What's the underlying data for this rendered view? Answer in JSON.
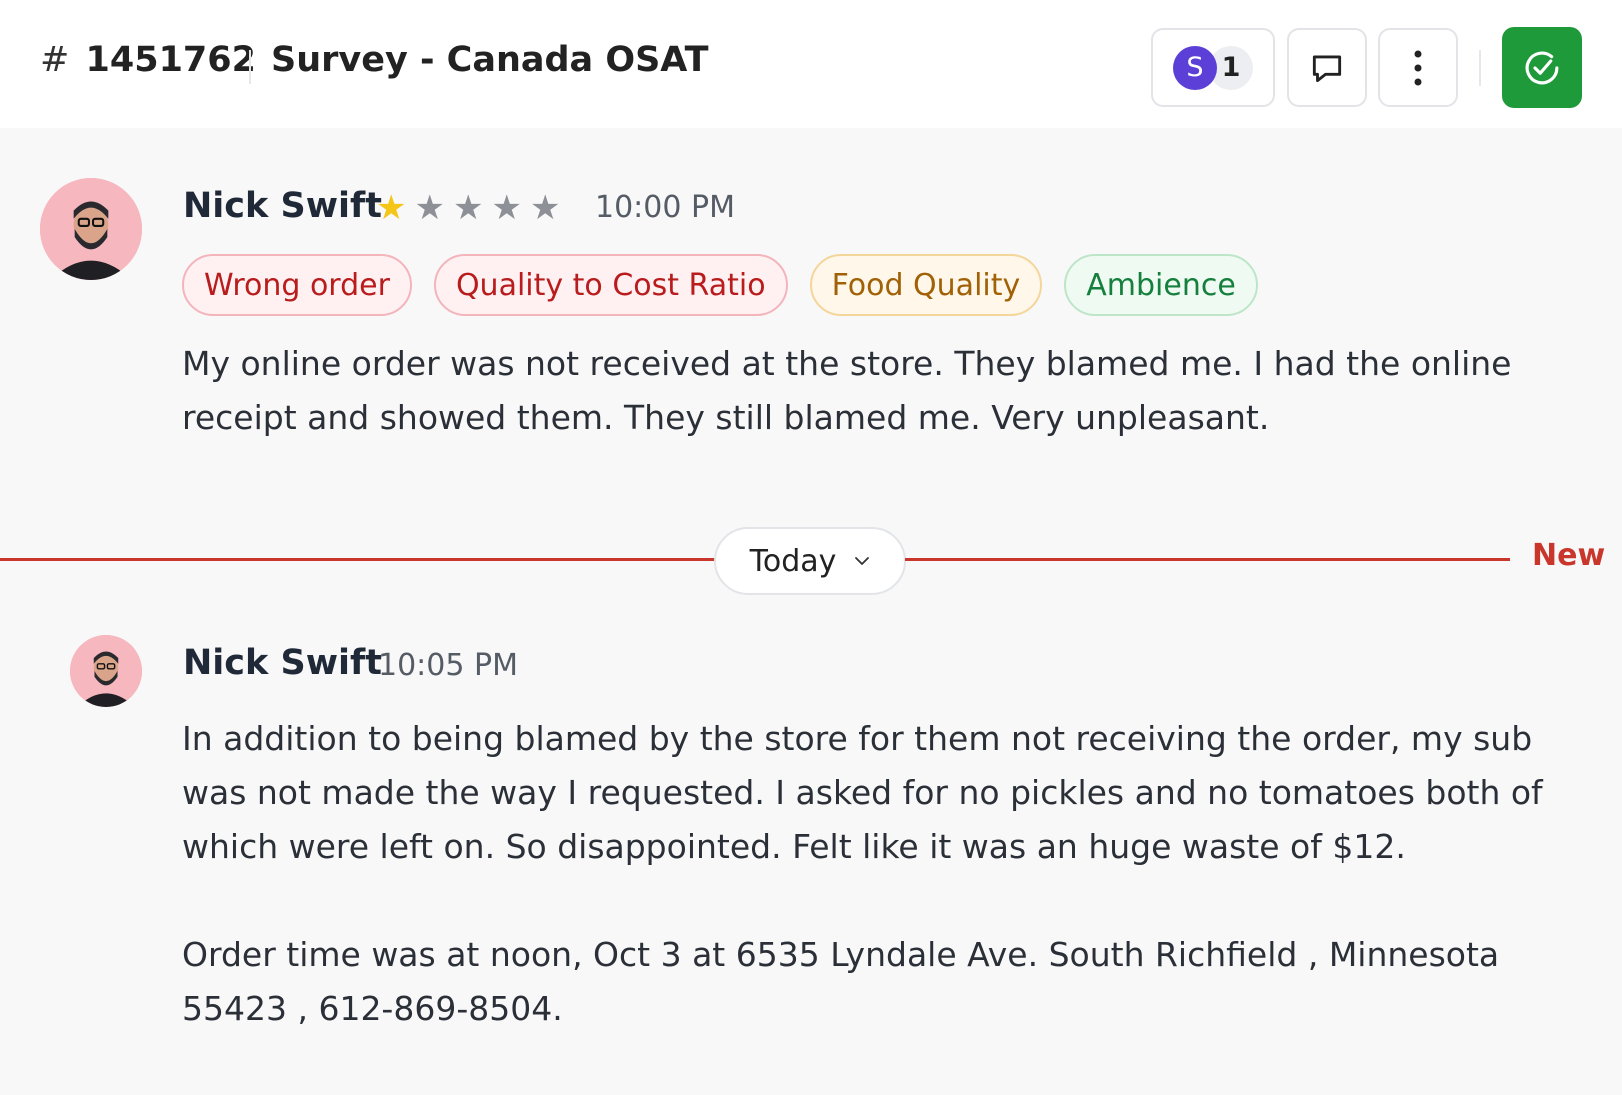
{
  "header": {
    "hash": "#",
    "ticket_id": "1451762",
    "title": "Survey - Canada OSAT",
    "assignee_initial": "S",
    "assignee_count": "1",
    "icons": [
      "chat-bubble-icon",
      "more-vertical-icon",
      "check-circle-icon"
    ],
    "resolve_color": "#1f9a3a"
  },
  "messages": [
    {
      "author": "Nick Swift",
      "rating": 1,
      "rating_max": 5,
      "time": "10:00 PM",
      "tags": [
        {
          "label": "Wrong order",
          "tone": "red"
        },
        {
          "label": "Quality to Cost Ratio",
          "tone": "red"
        },
        {
          "label": "Food Quality",
          "tone": "orange"
        },
        {
          "label": "Ambience",
          "tone": "green"
        }
      ],
      "text": "My online order was not received at the store. They blamed me. I had the online receipt and showed them. They still blamed me. Very unpleasant."
    },
    {
      "author": "Nick Swift",
      "time": "10:05 PM",
      "text": "In addition to being blamed by the store for them not receiving the order,  my sub was not made the way I requested. I asked for no pickles and no tomatoes both of which were left on. So disappointed. Felt like it was an huge waste of $12.",
      "text2": "Order time was at noon, Oct 3 at 6535 Lyndale Ave. South Richfield , Minnesota 55423 , 612-869-8504."
    }
  ],
  "divider": {
    "label": "Today",
    "new_label": "New",
    "accent": "#c9372c"
  }
}
